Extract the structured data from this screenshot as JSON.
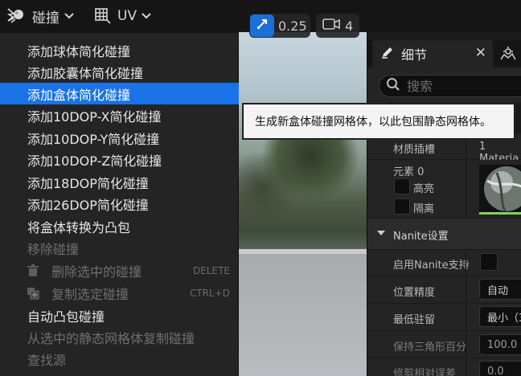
{
  "toolbar": {
    "collision_label": "碰撞",
    "uv_label": "UV"
  },
  "viewport": {
    "snap_value": "0.25",
    "camera_speed": "4"
  },
  "menu": {
    "items": [
      {
        "label": "添加球体简化碰撞",
        "state": "normal"
      },
      {
        "label": "添加胶囊体简化碰撞",
        "state": "normal"
      },
      {
        "label": "添加盒体简化碰撞",
        "state": "selected"
      },
      {
        "label": "添加10DOP-X简化碰撞",
        "state": "normal"
      },
      {
        "label": "添加10DOP-Y简化碰撞",
        "state": "normal"
      },
      {
        "label": "添加10DOP-Z简化碰撞",
        "state": "normal"
      },
      {
        "label": "添加18DOP简化碰撞",
        "state": "normal"
      },
      {
        "label": "添加26DOP简化碰撞",
        "state": "normal"
      },
      {
        "label": "将盒体转换为凸包",
        "state": "normal"
      },
      {
        "label": "移除碰撞",
        "state": "disabled"
      },
      {
        "label": "删除选中的碰撞",
        "state": "disabled",
        "shortcut": "DELETE",
        "icon": "trash-icon"
      },
      {
        "label": "复制选定碰撞",
        "state": "disabled",
        "shortcut": "CTRL+D",
        "icon": "duplicate-icon"
      },
      {
        "label": "自动凸包碰撞",
        "state": "normal"
      },
      {
        "label": "从选中的静态网格体复制碰撞",
        "state": "disabled"
      },
      {
        "label": "查找源",
        "state": "disabled"
      }
    ]
  },
  "tooltip": {
    "text": "生成新盒体碰撞网格体，以此包围静态网格体。"
  },
  "details": {
    "title": "细节",
    "search_placeholder": "搜索",
    "material_slot_label": "材质插槽",
    "material_slot_value": "1 Materia",
    "element_label": "元素 0",
    "highlight_label": "高亮",
    "isolate_label": "隔离",
    "nanite_section": "Nanite设置",
    "enable_nanite_label": "启用Nanite支持",
    "position_precision_label": "位置精度",
    "position_precision_value": "自动",
    "min_residency_label": "最低驻留",
    "min_residency_value": "最小（3",
    "keep_triangle_label": "保持三角形百分",
    "keep_triangle_value": "100.0",
    "trim_error_label": "修剪相对误差",
    "trim_error_value": "0.0"
  },
  "colors": {
    "accent_blue": "#1a73e6",
    "menu_bg": "#242424",
    "tooltip_bg": "#f4f4f4"
  }
}
